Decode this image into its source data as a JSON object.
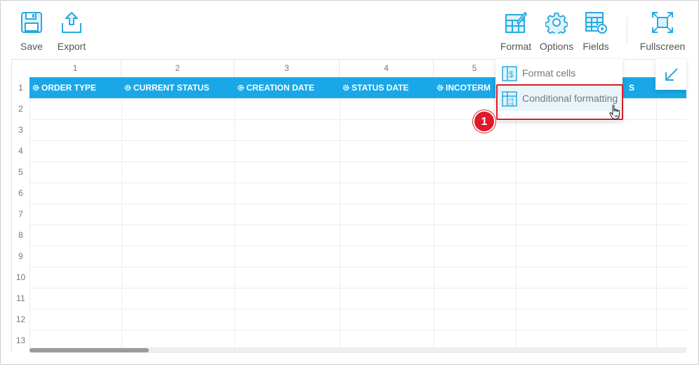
{
  "toolbar": {
    "save_label": "Save",
    "export_label": "Export",
    "format_label": "Format",
    "options_label": "Options",
    "fields_label": "Fields",
    "fullscreen_label": "Fullscreen"
  },
  "grid": {
    "column_numbers": [
      "1",
      "2",
      "3",
      "4",
      "5"
    ],
    "row_numbers": [
      "1",
      "2",
      "3",
      "4",
      "5",
      "6",
      "7",
      "8",
      "9",
      "10",
      "11",
      "12",
      "13"
    ],
    "header_cells": [
      "ORDER TYPE",
      "CURRENT STATUS",
      "CREATION DATE",
      "STATUS DATE",
      "INCOTERM"
    ],
    "partial_header_suffix": "S"
  },
  "format_menu": {
    "items": [
      {
        "label": "Format cells",
        "icon": "format-cells-icon"
      },
      {
        "label": "Conditional formatting",
        "icon": "conditional-formatting-icon"
      }
    ]
  },
  "annotation": {
    "step_number": "1"
  },
  "colors": {
    "accent": "#1aa7e8",
    "highlight_red": "#e0192b",
    "icon_blue": "#29a9e1"
  }
}
